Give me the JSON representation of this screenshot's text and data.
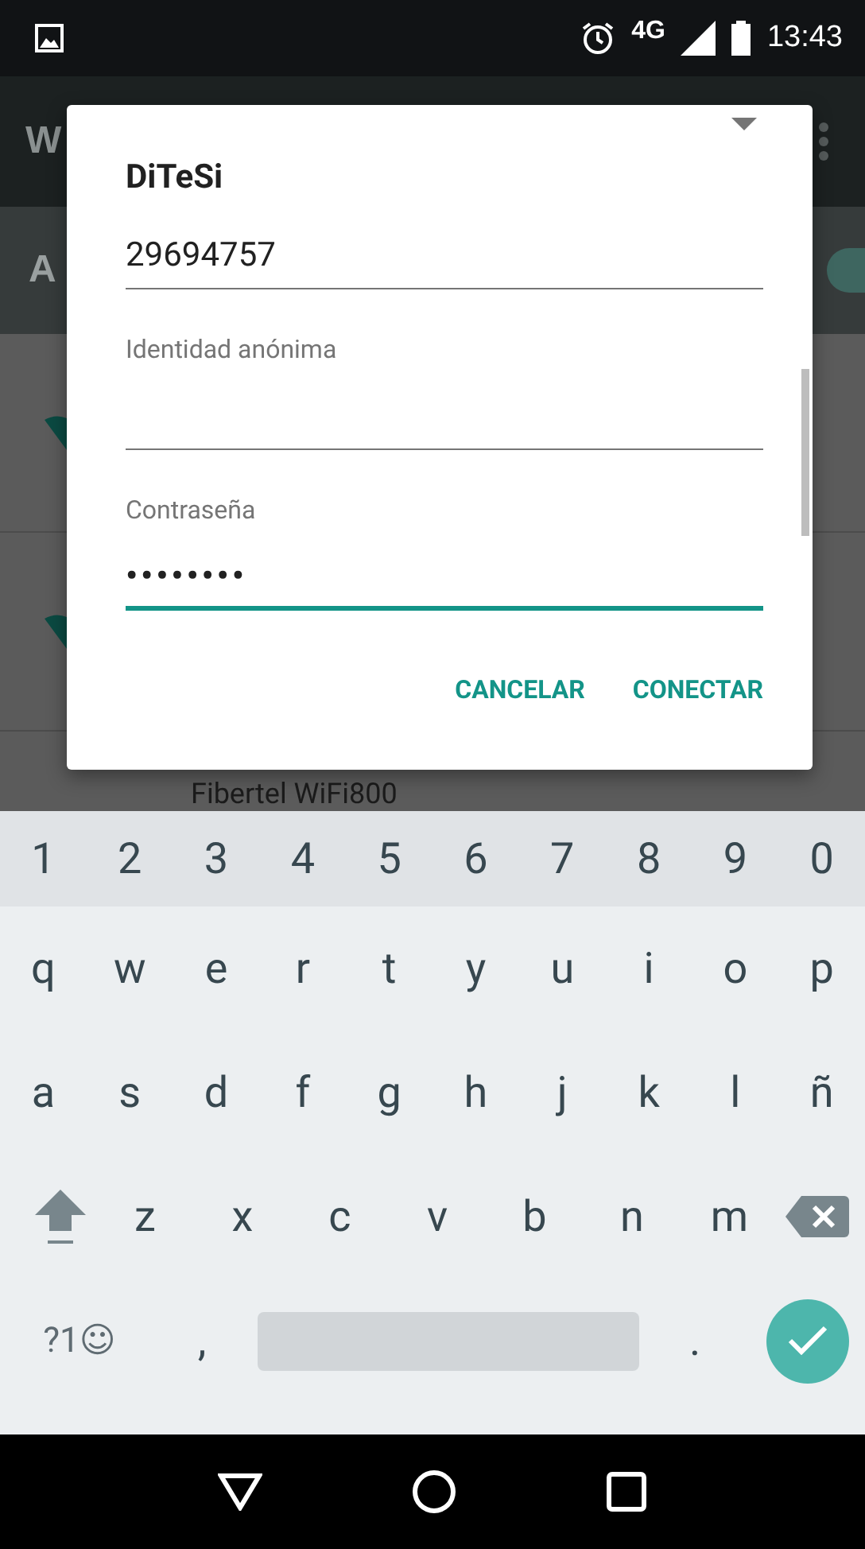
{
  "status_bar": {
    "network": "4G",
    "time": "13:43"
  },
  "background": {
    "app_bar_title": "W",
    "switch_label": "A",
    "switch_on": true,
    "networks": [
      {
        "kind": "icon"
      },
      {
        "kind": "icon"
      },
      {
        "kind": "name",
        "name": "Fibertel WiFi800"
      }
    ]
  },
  "dialog": {
    "title": "DiTeSi",
    "fields": [
      {
        "value": "29694757",
        "focused": false
      },
      {
        "label": "Identidad anónima",
        "focused": false
      },
      {
        "label": "Contraseña",
        "value": "••••••••",
        "focused": true
      }
    ],
    "buttons": [
      "CANCELAR",
      "CONECTAR"
    ]
  },
  "keyboard": {
    "rows": [
      {
        "kind": "numbers",
        "keys": [
          "1",
          "2",
          "3",
          "4",
          "5",
          "6",
          "7",
          "8",
          "9",
          "0"
        ]
      },
      {
        "kind": "letters",
        "keys": [
          "q",
          "w",
          "e",
          "r",
          "t",
          "y",
          "u",
          "i",
          "o",
          "p"
        ]
      },
      {
        "kind": "letters",
        "keys": [
          "a",
          "s",
          "d",
          "f",
          "g",
          "h",
          "j",
          "k",
          "l",
          "ñ"
        ]
      },
      {
        "kind": "shift",
        "keys": [
          "z",
          "x",
          "c",
          "v",
          "b",
          "n",
          "m"
        ]
      },
      {
        "kind": "bottom",
        "keys": [
          "?1☺",
          ",",
          "."
        ]
      }
    ]
  }
}
